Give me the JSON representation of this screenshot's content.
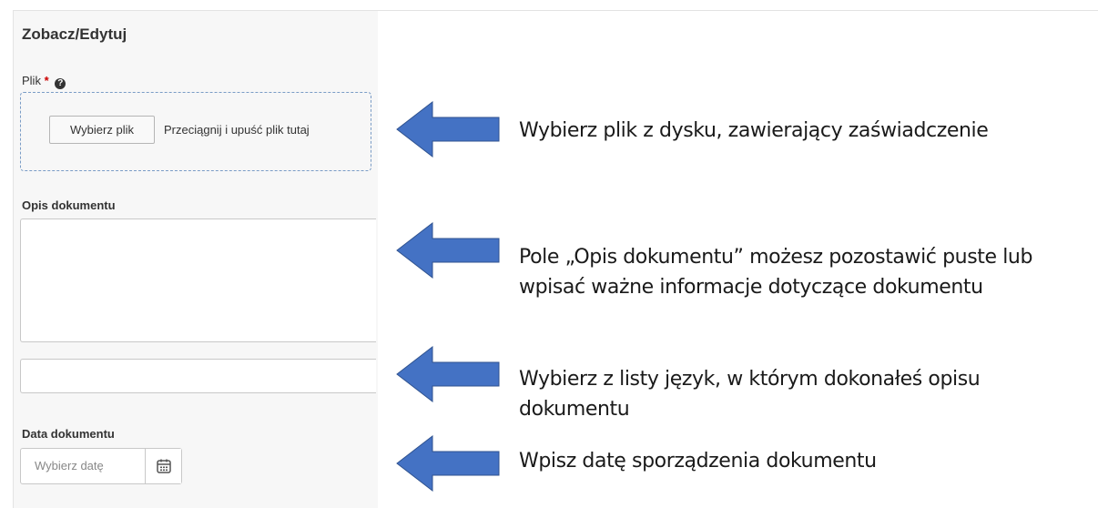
{
  "form": {
    "title": "Zobacz/Edytuj",
    "file_label": "Plik",
    "required_mark": "*",
    "help_glyph": "?",
    "choose_file_button": "Wybierz plik",
    "drop_text": "Przeciągnij i upuść plik tutaj",
    "description_label": "Opis dokumentu",
    "description_value": "",
    "language_value": "",
    "date_label": "Data dokumentu",
    "date_placeholder": "Wybierz datę"
  },
  "annotations": {
    "file": "Wybierz plik z dysku, zawierający zaświadczenie",
    "description_line1": "Pole „Opis dokumentu” możesz pozostawić puste lub",
    "description_line2": "wpisać ważne informacje dotyczące dokumentu",
    "language_line1": "Wybierz z listy język, w którym dokonałeś opisu",
    "language_line2": "dokumentu",
    "date": "Wpisz datę sporządzenia dokumentu"
  },
  "colors": {
    "arrow_fill": "#4472c4",
    "arrow_stroke": "#2f528f",
    "required": "#cc0000",
    "dropzone_border": "#7a9cc6"
  },
  "icons": {
    "help": "question-circle-icon",
    "date_button": "calendar-icon",
    "pointer": "left-arrow-icon"
  }
}
